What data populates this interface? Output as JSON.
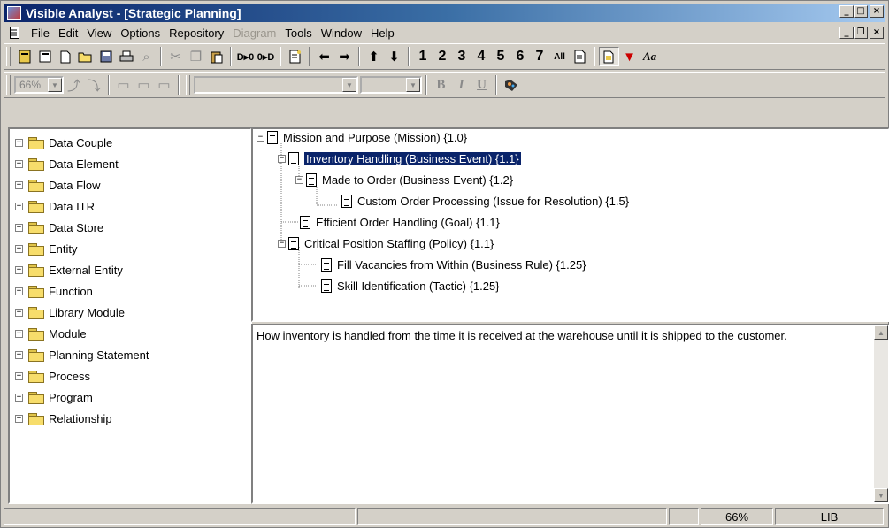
{
  "window": {
    "title": "Visible Analyst - [Strategic Planning]"
  },
  "menu": [
    "File",
    "Edit",
    "View",
    "Options",
    "Repository",
    "Diagram",
    "Tools",
    "Window",
    "Help"
  ],
  "toolbar1": {
    "levels": [
      "1",
      "2",
      "3",
      "4",
      "5",
      "6",
      "7"
    ],
    "all_label": "All",
    "font_label": "Aa"
  },
  "toolbar2": {
    "zoom_value": "66%",
    "bold": "B",
    "italic": "I",
    "underline": "U"
  },
  "left_tree": [
    "Data Couple",
    "Data Element",
    "Data Flow",
    "Data ITR",
    "Data Store",
    "Entity",
    "External Entity",
    "Function",
    "Library Module",
    "Module",
    "Planning Statement",
    "Process",
    "Program",
    "Relationship"
  ],
  "planning_tree": [
    {
      "label": "Mission and Purpose (Mission) {1.0}",
      "level": 0,
      "expander": "-"
    },
    {
      "label": "Inventory Handling (Business Event) {1.1}",
      "level": 1,
      "expander": "-",
      "selected": true
    },
    {
      "label": "Made to Order (Business Event) {1.2}",
      "level": 2,
      "expander": "-"
    },
    {
      "label": "Custom Order Processing (Issue for Resolution) {1.5}",
      "level": 3
    },
    {
      "label": "Efficient Order Handling (Goal) {1.1}",
      "level": 1
    },
    {
      "label": "Critical Position Staffing (Policy) {1.1}",
      "level": 1,
      "expander": "-"
    },
    {
      "label": "Fill Vacancies from Within (Business Rule) {1.25}",
      "level": 2
    },
    {
      "label": "Skill Identification (Tactic) {1.25}",
      "level": 2
    }
  ],
  "description": "How inventory is handled from the time it is received at the warehouse until it is shipped to the customer.",
  "status": {
    "zoom": "66%",
    "mode": "LIB"
  }
}
